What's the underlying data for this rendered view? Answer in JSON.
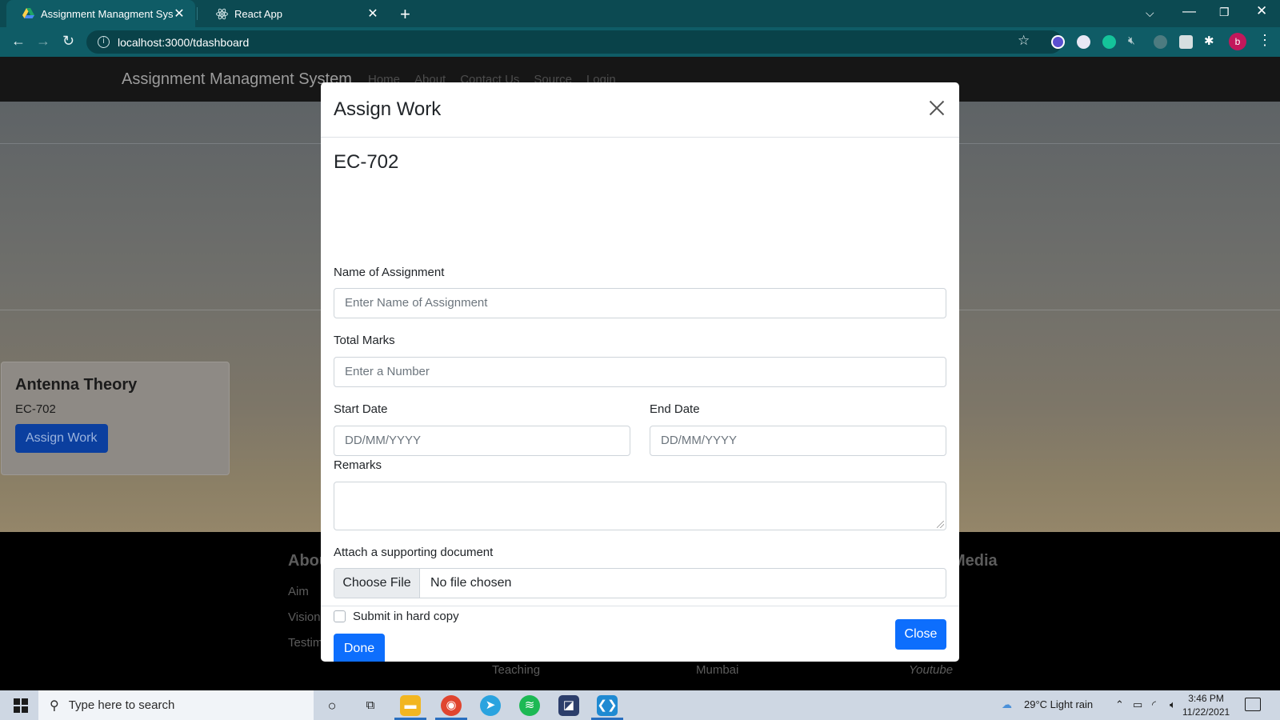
{
  "browser": {
    "tabs": [
      {
        "title": "Assignment Managment System",
        "icon": "google-drive-icon"
      },
      {
        "title": "React App",
        "icon": "react-icon"
      }
    ],
    "url": "localhost:3000/tdashboard"
  },
  "app": {
    "brand": "Assignment Managment System",
    "nav_links": [
      "Home",
      "About",
      "Contact Us",
      "Source",
      "Login"
    ]
  },
  "course_card": {
    "title": "Antenna Theory",
    "code": "EC-702",
    "button": "Assign Work"
  },
  "footer": {
    "about_heading": "Abou",
    "media_heading": "Media",
    "links": [
      "Aim",
      "Vision",
      "Testim",
      "Teaching",
      "Mumbai",
      "Youtube"
    ]
  },
  "modal": {
    "title": "Assign Work",
    "course_code": "EC-702",
    "name_label": "Name of Assignment",
    "name_placeholder": "Enter Name of Assignment",
    "marks_label": "Total Marks",
    "marks_placeholder": "Enter a Number",
    "start_label": "Start Date",
    "start_placeholder": "DD/MM/YYYY",
    "end_label": "End Date",
    "end_placeholder": "DD/MM/YYYY",
    "remarks_label": "Remarks",
    "attach_label": "Attach a supporting document",
    "choose_file": "Choose File",
    "file_status": "No file chosen",
    "hardcopy_label": "Submit in hard copy",
    "hardcopy_checked": false,
    "done": "Done",
    "close": "Close"
  },
  "taskbar": {
    "search_placeholder": "Type here to search",
    "weather": "29°C  Light rain",
    "time": "3:46 PM",
    "date": "11/22/2021"
  },
  "colors": {
    "chrome_frame": "#0c4a52",
    "primary_button": "#0d6efd",
    "navbar": "#161616"
  }
}
